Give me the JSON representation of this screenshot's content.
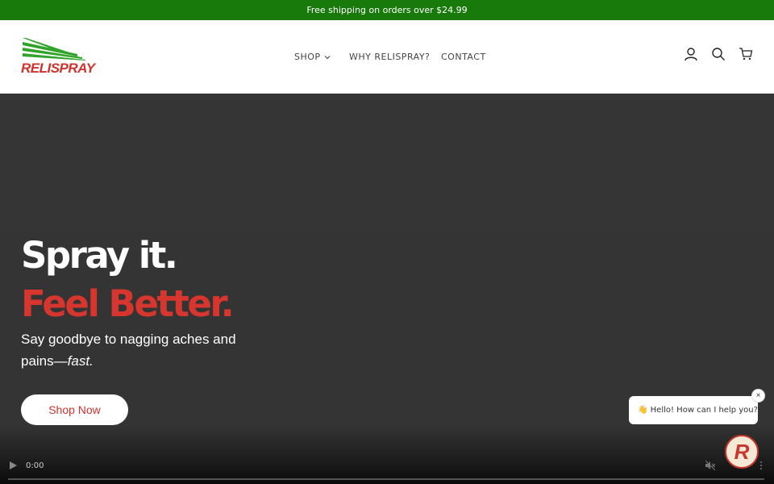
{
  "announcement": {
    "text": "Free shipping on orders over $24.99"
  },
  "brand": {
    "name": "RELISPRAY",
    "primary_green": "#187a0a",
    "accent_red": "#d2322d"
  },
  "nav": {
    "items": [
      {
        "label": "SHOP",
        "has_dropdown": true
      },
      {
        "label": "WHY RELISPRAY?",
        "has_dropdown": false
      },
      {
        "label": "CONTACT",
        "has_dropdown": false
      }
    ]
  },
  "header_icons": [
    "account-icon",
    "search-icon",
    "cart-icon"
  ],
  "hero": {
    "line1": "Spray it.",
    "line2": "Feel Better.",
    "subtitle_main": "Say goodbye to nagging aches and pains—",
    "subtitle_em": "fast.",
    "cta_label": "Shop Now"
  },
  "video": {
    "time": "0:00"
  },
  "chat": {
    "greeting_emoji": "👋",
    "greeting_text": "Hello! How can I help you?",
    "close_label": "×",
    "launcher_letter": "R"
  }
}
